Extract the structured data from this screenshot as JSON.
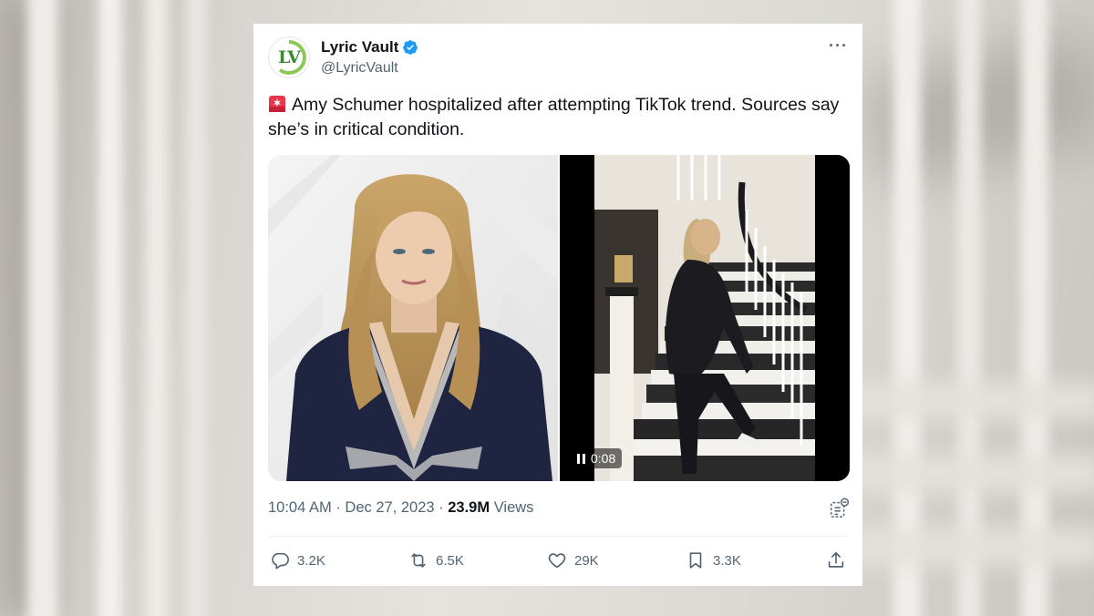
{
  "account": {
    "avatar_text": "LV",
    "name": "Lyric Vault",
    "handle": "@LyricVault",
    "verified": true
  },
  "tweet": {
    "text": "Amy Schumer hospitalized after attempting TikTok trend. Sources say she’s in critical condition.",
    "leading_icon": "rotating-light-icon"
  },
  "media": {
    "video_time": "0:08"
  },
  "meta": {
    "time": "10:04 AM",
    "separator": "·",
    "date": "Dec 27, 2023",
    "views_count": "23.9M",
    "views_label": "Views"
  },
  "actions": {
    "replies": "3.2K",
    "reposts": "6.5K",
    "likes": "29K",
    "bookmarks": "3.3K"
  },
  "colors": {
    "text": "#0f1419",
    "secondary": "#536471",
    "verified_blue": "#1d9bf0",
    "brand_green": "#3d8a35"
  }
}
